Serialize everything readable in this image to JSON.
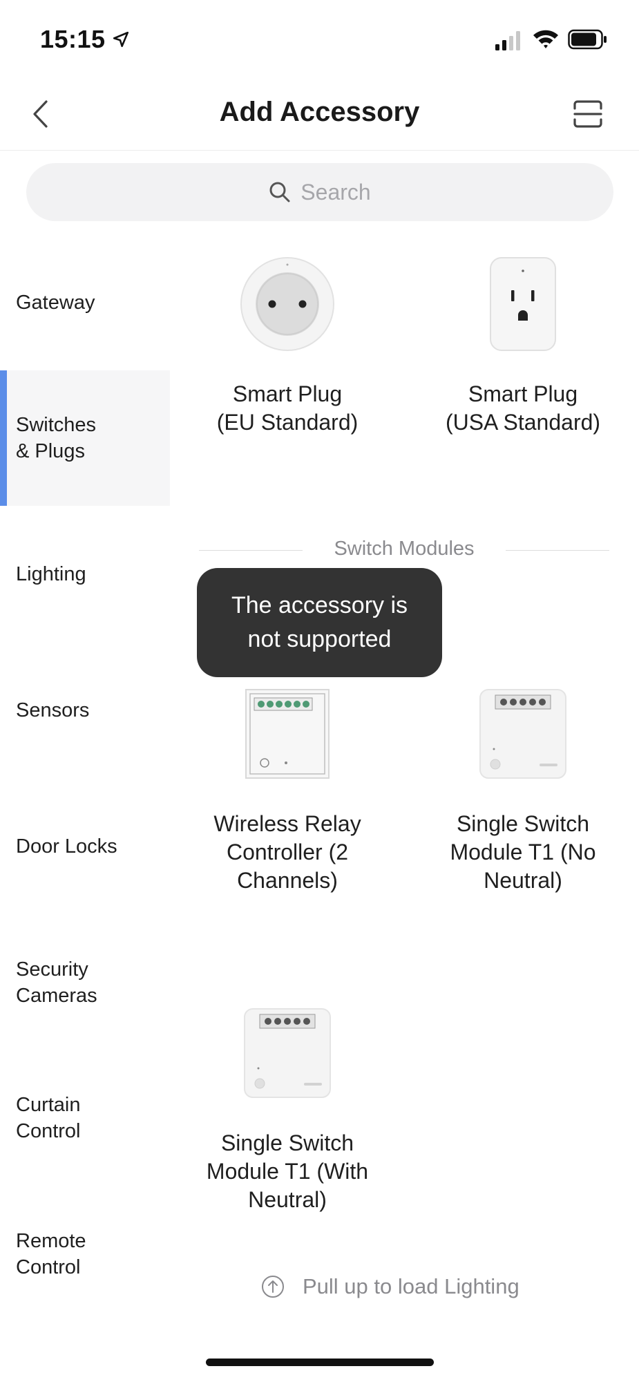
{
  "status_bar": {
    "time": "15:15"
  },
  "nav": {
    "title": "Add Accessory",
    "back_icon": "chevron-left-icon",
    "scan_icon": "scan-icon"
  },
  "search": {
    "placeholder": "Search"
  },
  "sidebar": {
    "items": [
      {
        "label": "Gateway",
        "active": false
      },
      {
        "label": "Switches\n& Plugs",
        "active": true
      },
      {
        "label": "Lighting",
        "active": false
      },
      {
        "label": "Sensors",
        "active": false
      },
      {
        "label": "Door Locks",
        "active": false
      },
      {
        "label": "Security\nCameras",
        "active": false
      },
      {
        "label": "Curtain\nControl",
        "active": false
      },
      {
        "label": "Remote\nControl",
        "active": false
      }
    ],
    "active_color": "#5b8de8"
  },
  "content": {
    "plugs": [
      {
        "label": "Smart Plug\n(EU Standard)",
        "icon": "eu-plug-icon"
      },
      {
        "label": "Smart Plug\n(USA Standard)",
        "icon": "us-plug-icon"
      }
    ],
    "section_title": "Switch Modules",
    "modules": [
      {
        "label": "Wireless Relay\nController (2\nChannels)",
        "icon": "relay-controller-icon"
      },
      {
        "label": "Single Switch\nModule T1 (No\nNeutral)",
        "icon": "switch-module-icon"
      },
      {
        "label": "Single Switch\nModule T1 (With\nNeutral)",
        "icon": "switch-module-icon"
      }
    ]
  },
  "toast": {
    "message": "The accessory is\nnot supported"
  },
  "footer": {
    "pull_up_text": "Pull up to load Lighting"
  }
}
